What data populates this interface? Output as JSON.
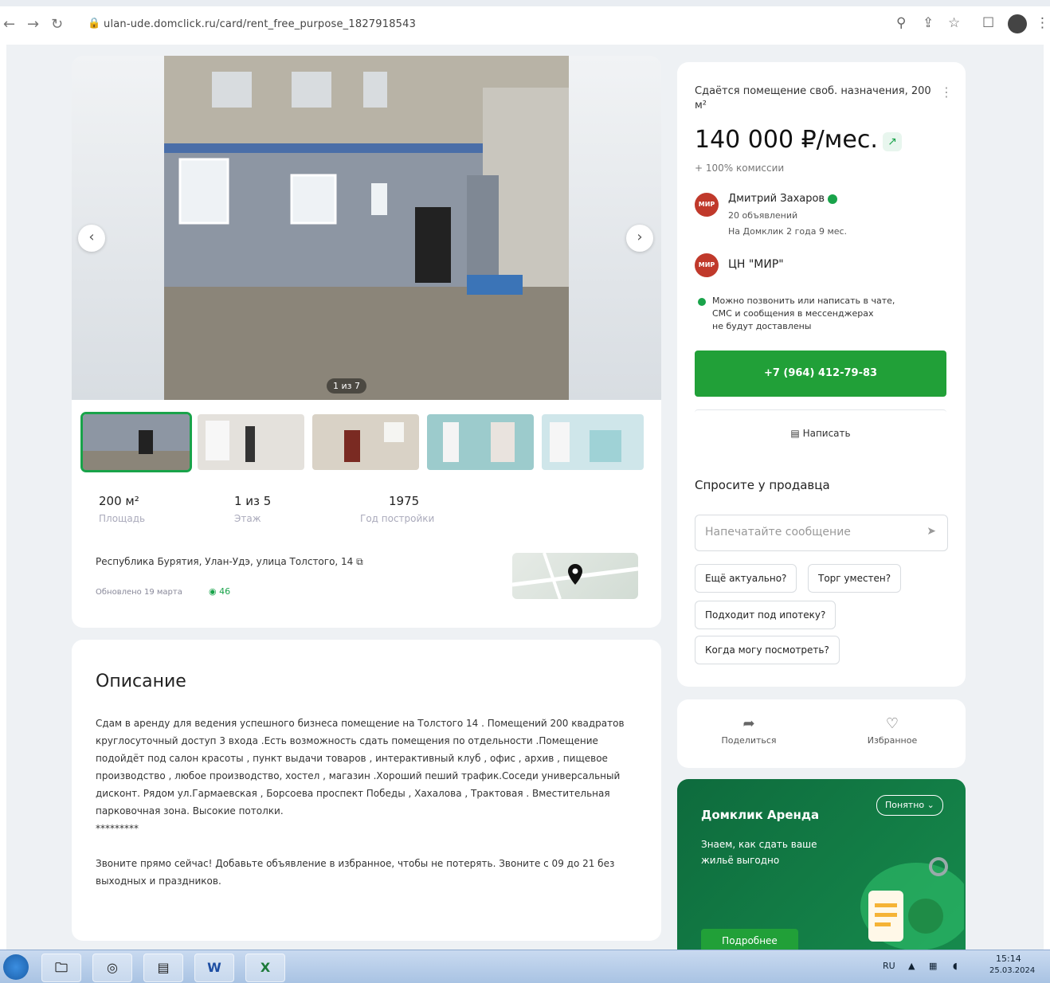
{
  "browser": {
    "url": "ulan-ude.domclick.ru/card/rent_free_purpose_1827918543"
  },
  "gallery": {
    "counter": "1 из 7",
    "prev_label": "‹",
    "next_label": "›"
  },
  "stats": [
    {
      "value": "200 м²",
      "label": "Площадь"
    },
    {
      "value": "1 из 5",
      "label": "Этаж"
    },
    {
      "value": "1975",
      "label": "Год постройки"
    }
  ],
  "location": {
    "address": "Республика Бурятия, Улан-Удэ, улица Толстого, 14",
    "updated": "Обновлено 19 марта",
    "views": "46"
  },
  "description": {
    "title": "Описание",
    "text": "Сдам в аренду для ведения успешного бизнеса помещение на Толстого 14 . Помещений 200 квадратов круглосуточный доступ 3 входа .Есть возможность сдать помещения по отдельности .Помещение подойдёт под салон красоты , пункт выдачи товаров , интерактивный клуб , офис , архив , пищевое производство , любое производство, хостел , магазин .Хороший пеший трафик.Соседи универсальный дисконт. Рядом ул.Гармаевская , Борсоева проспект Победы , Хахалова , Трактовая . Вместительная парковочная зона. Высокие потолки.\n*********\n\n Звоните прямо сейчас! Добавьте объявление в избранное, чтобы не потерять. Звоните с 09 до 21 без выходных и праздников."
  },
  "sidebar": {
    "listing_title": "Сдаётся помещение своб. назначения, 200 м²",
    "price": "140 000 ₽/мес.",
    "commission": "+ 100% комиссии",
    "agent_name": "Дмитрий Захаров",
    "agent_listings": "20 объявлений",
    "agent_tenure": "На Домклик 2 года 9 мес.",
    "agency_name": "ЦН \"МИР\"",
    "notice": "Можно позвонить или написать в чате,\nСМС и сообщения в мессенджерах\nне будут доставлены",
    "phone_button": "+7 (964) 412-79-83",
    "message_button": "Написать",
    "ask_title": "Спросите у продавца",
    "ask_placeholder": "Напечатайте сообщение",
    "quick_questions": [
      "Ещё актуально?",
      "Торг уместен?",
      "Подходит под ипотеку?",
      "Когда могу посмотреть?"
    ]
  },
  "actions": {
    "share": "Поделиться",
    "favorite": "Избранное"
  },
  "promo": {
    "title": "Домклик Аренда",
    "text": "Знаем, как сдать ваше жильё выгодно",
    "select": "Понятно",
    "button": "Подробнее"
  },
  "taskbar": {
    "lang": "RU",
    "time": "15:14",
    "date": "25.03.2024"
  },
  "colors": {
    "accent": "#21a038",
    "promo_bg": "#0e6b3d",
    "page_bg": "#eef1f4"
  }
}
